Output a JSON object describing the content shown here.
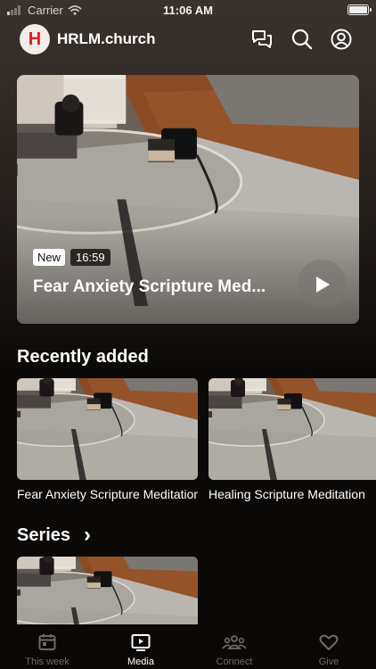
{
  "status_bar": {
    "carrier": "Carrier",
    "time": "11:06 AM"
  },
  "header": {
    "logo_letter": "H",
    "title": "HRLM.church",
    "icons": [
      "chat-icon",
      "search-icon",
      "profile-icon"
    ]
  },
  "featured": {
    "badge": "New",
    "duration": "16:59",
    "title": "Fear Anxiety Scripture Med..."
  },
  "recently_added": {
    "title": "Recently added",
    "items": [
      {
        "label": "Fear Anxiety Scripture Meditation"
      },
      {
        "label": "Healing Scripture Meditation"
      }
    ]
  },
  "series": {
    "title": "Series",
    "chevron": "›"
  },
  "tabs": [
    {
      "label": "This week",
      "icon": "calendar-icon",
      "active": false
    },
    {
      "label": "Media",
      "icon": "media-icon",
      "active": true
    },
    {
      "label": "Connect",
      "icon": "people-icon",
      "active": false
    },
    {
      "label": "Give",
      "icon": "heart-icon",
      "active": false
    }
  ],
  "colors": {
    "background": "#0b0908",
    "accent": "#e01e27",
    "inactive_tab": "#6f6a66"
  }
}
